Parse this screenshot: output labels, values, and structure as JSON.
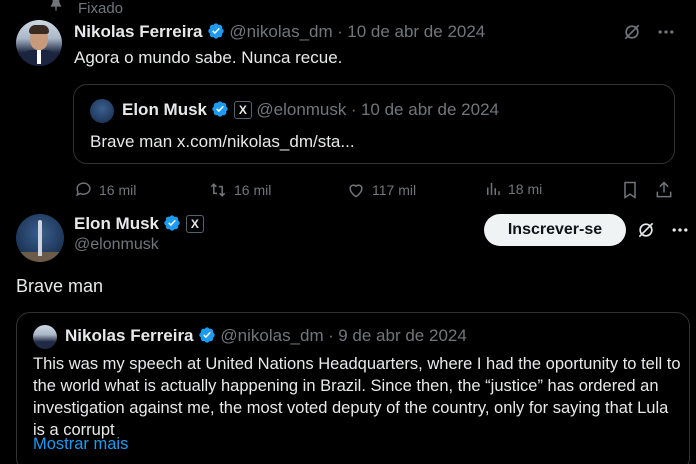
{
  "pinned_label": "Fixado",
  "tweet1": {
    "author_name": "Nikolas Ferreira",
    "author_handle": "@nikolas_dm",
    "date": "10 de abr de 2024",
    "text": "Agora o mundo sabe. Nunca recue.",
    "quote": {
      "author_name": "Elon Musk",
      "author_handle": "@elonmusk",
      "date": "10 de abr de 2024",
      "text": "Brave man x.com/nikolas_dm/sta..."
    },
    "metrics": {
      "replies": "16 mil",
      "reposts": "16 mil",
      "likes": "117 mil",
      "views": "18 mi"
    }
  },
  "tweet2": {
    "author_name": "Elon Musk",
    "author_handle": "@elonmusk",
    "subscribe_label": "Inscrever-se",
    "text": "Brave man",
    "quote": {
      "author_name": "Nikolas Ferreira",
      "author_handle": "@nikolas_dm",
      "date": "9 de abr de 2024",
      "text": "This was my speech at United Nations Headquarters, where I had the oportunity to tell to the world what is actually happening in Brazil. Since then, the “justice” has ordered an investigation against me, the most voted deputy of the country, only for saying that Lula is a corrupt",
      "show_more": "Mostrar mais"
    }
  },
  "colors": {
    "background": "#000000",
    "text": "#e7e9ea",
    "muted": "#71767b",
    "verified": "#1d9bf0",
    "border": "#2f3336"
  }
}
